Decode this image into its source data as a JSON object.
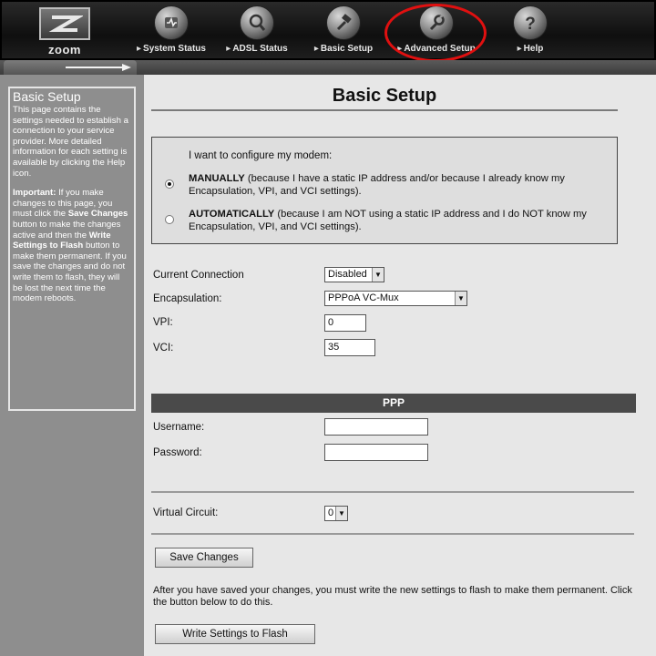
{
  "nav": {
    "logo": "zoom",
    "items": [
      {
        "label": "System Status",
        "icon": "status-icon"
      },
      {
        "label": "ADSL Status",
        "icon": "magnifier-icon"
      },
      {
        "label": "Basic Setup",
        "icon": "hammer-icon"
      },
      {
        "label": "Advanced Setup",
        "icon": "wrench-icon"
      },
      {
        "label": "Help",
        "icon": "question-icon"
      }
    ],
    "highlight_color": "#e01010"
  },
  "sidebar": {
    "title": "Basic Setup",
    "intro": "This page contains the settings needed to establish a connection to your service provider. More detailed information for each setting is available by clicking the Help icon.",
    "important_label": "Important:",
    "important_text_1": " If you make changes to this page, you must click the ",
    "save_changes_ref": "Save Changes",
    "important_text_2": " button to make the changes active and then the ",
    "write_settings_ref": "Write Settings to Flash",
    "important_text_3": " button to make them permanent. If you save the changes and do not write them to flash, they will be lost the next time the modem reboots."
  },
  "main": {
    "title": "Basic Setup",
    "mode": {
      "prompt": "I want to configure my modem:",
      "manual_label": "MANUALLY",
      "manual_text": " (because I have a static IP address and/or because I already know my Encapsulation, VPI, and VCI settings).",
      "auto_label": "AUTOMATICALLY",
      "auto_text": " (because I am NOT using a static IP address and I do NOT know my Encapsulation, VPI, and VCI settings).",
      "selected": "MANUALLY"
    },
    "fields": {
      "current_connection_label": "Current Connection",
      "current_connection_value": "Disabled",
      "encapsulation_label": "Encapsulation:",
      "encapsulation_value": "PPPoA VC-Mux",
      "vpi_label": "VPI:",
      "vpi_value": "0",
      "vci_label": "VCI:",
      "vci_value": "35"
    },
    "ppp": {
      "header": "PPP",
      "username_label": "Username:",
      "username_value": "",
      "password_label": "Password:",
      "password_value": ""
    },
    "virtual_circuit_label": "Virtual Circuit:",
    "virtual_circuit_value": "0",
    "save_button": "Save Changes",
    "flash_note": "After you have saved your changes, you must write the new settings to flash to make them permanent. Click the button below to do this.",
    "flash_button": "Write Settings to Flash"
  }
}
